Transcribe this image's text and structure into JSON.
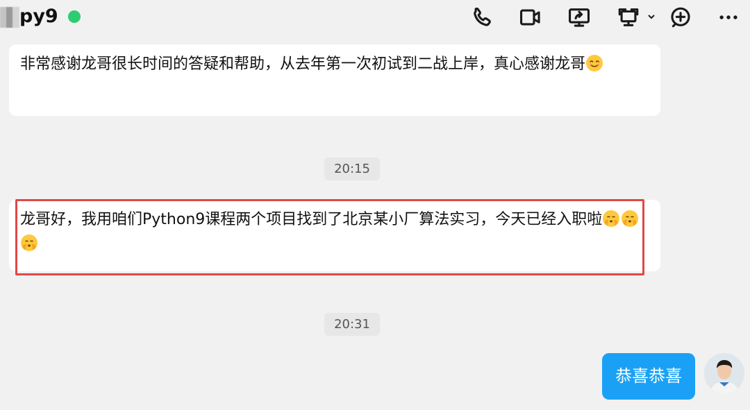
{
  "header": {
    "chat_name": "py9",
    "status_color": "#2ecc71",
    "icons": [
      "phone-icon",
      "video-call-icon",
      "screen-share-icon",
      "remote-desktop-icon",
      "chevron-down-icon",
      "add-icon",
      "more-icon"
    ]
  },
  "messages": [
    {
      "type": "incoming",
      "text": "非常感谢龙哥很长时间的答疑和帮助，从去年第一次初试到二战上岸，真心感谢龙哥",
      "emoji": "smiling-face-emoji"
    },
    {
      "type": "timestamp",
      "text": "20:15"
    },
    {
      "type": "incoming",
      "text": "龙哥好，我用咱们Python9课程两个项目找到了北京某小厂算法实习，今天已经入职啦",
      "emoji": "saluting-face-emoji",
      "emoji_count": 3,
      "highlighted": true,
      "highlight_color": "#e04848"
    },
    {
      "type": "timestamp",
      "text": "20:31"
    },
    {
      "type": "outgoing",
      "text": "恭喜恭喜",
      "bubble_color": "#1aa1f6"
    }
  ]
}
